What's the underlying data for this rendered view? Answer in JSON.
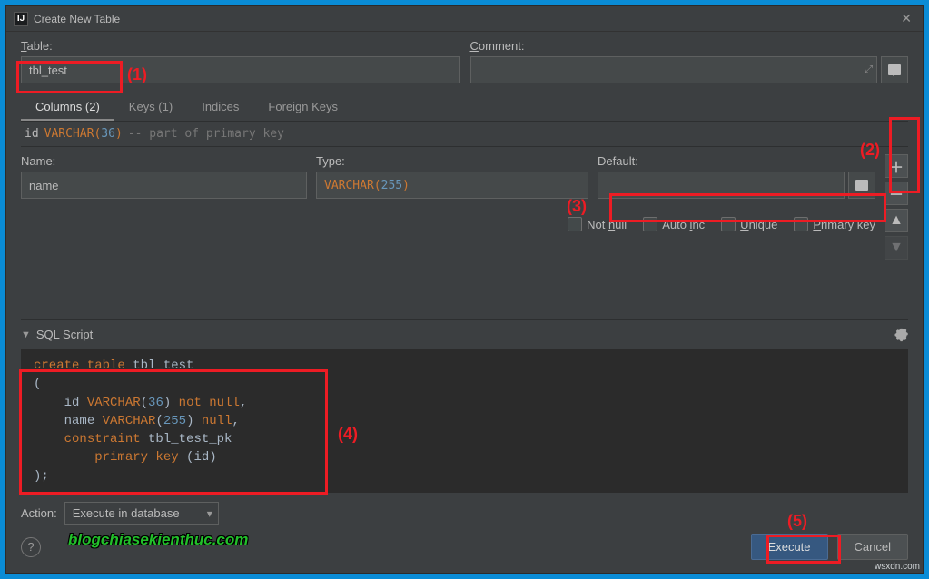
{
  "window": {
    "title": "Create New Table",
    "app_icon_text": "IJ"
  },
  "labels": {
    "table": "Table:",
    "comment": "Comment:",
    "name": "Name:",
    "type": "Type:",
    "default": "Default:",
    "not_null": "Not null",
    "auto_inc": "Auto inc",
    "unique": "Unique",
    "primary_key": "Primary key",
    "sql_script": "SQL Script",
    "action": "Action:"
  },
  "fields": {
    "table_name": "tbl_test",
    "comment": "",
    "col_name": "name",
    "col_type_prefix": "VARCHAR(",
    "col_type_num": "255",
    "col_type_suffix": ")",
    "col_default": "",
    "action_value": "Execute in database"
  },
  "tabs": [
    {
      "label": "Columns (2)",
      "active": true
    },
    {
      "label": "Keys (1)",
      "active": false
    },
    {
      "label": "Indices",
      "active": false
    },
    {
      "label": "Foreign Keys",
      "active": false
    }
  ],
  "column_row": {
    "name": "id",
    "type_prefix": "VARCHAR(",
    "type_num": "36",
    "type_suffix": ")",
    "comment": "-- part of primary key"
  },
  "sql": {
    "line1": "create table tbl_test",
    "line2": "(",
    "line3": "    id VARCHAR(36) not null,",
    "line4": "    name VARCHAR(255) null,",
    "line5": "    constraint tbl_test_pk",
    "line6": "        primary key (id)",
    "line7": ");"
  },
  "buttons": {
    "execute": "Execute",
    "cancel": "Cancel"
  },
  "annotations": {
    "a1": "(1)",
    "a2": "(2)",
    "a3": "(3)",
    "a4": "(4)",
    "a5": "(5)"
  },
  "watermark": "blogchiasekienthuc.com",
  "source_tag": "wsxdn.com"
}
